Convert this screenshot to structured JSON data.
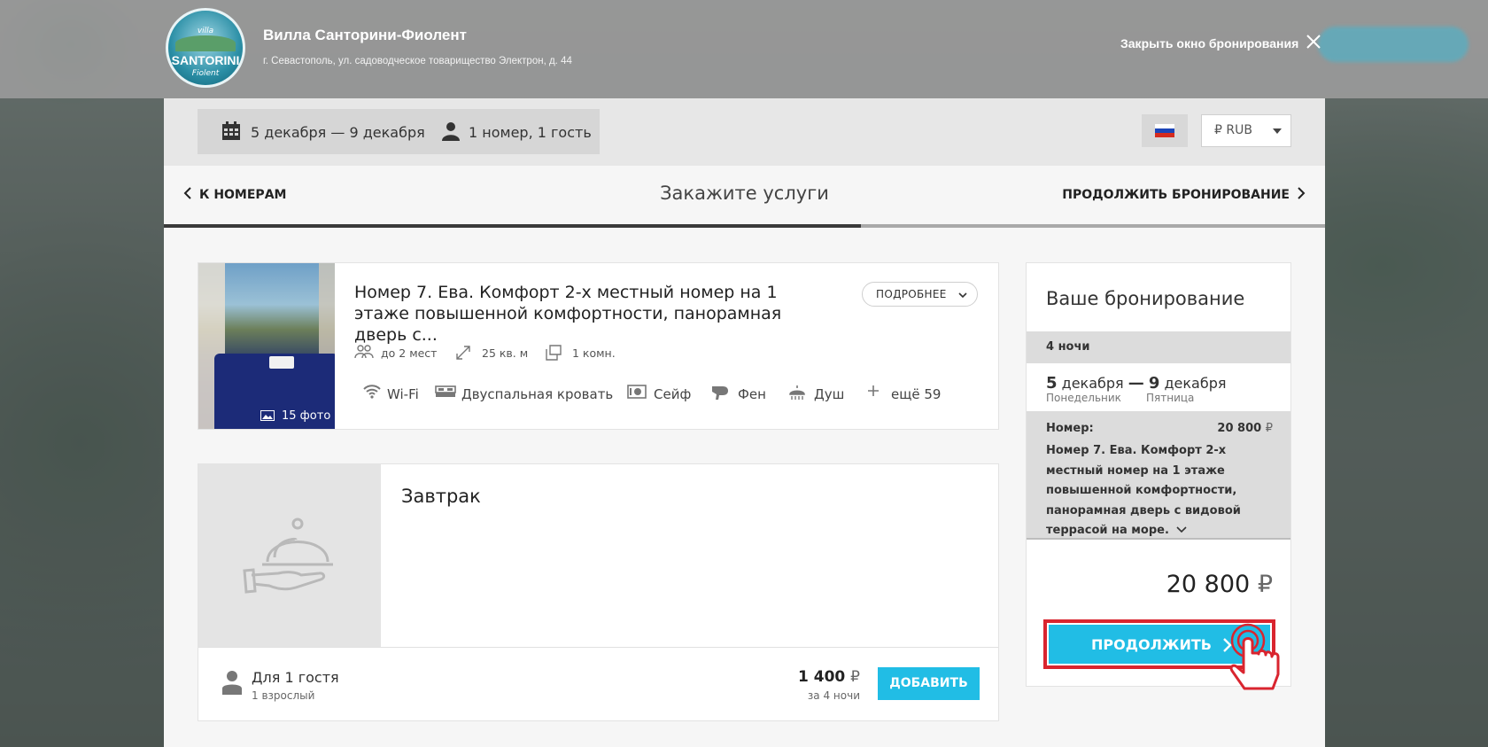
{
  "header": {
    "hotel_name": "Вилла Санторини-Фиолент",
    "address": "г. Севастополь, ул. садоводческое товарищество Электрон, д. 44",
    "close_label": "Закрыть окно бронирования",
    "logo": {
      "script": "villa",
      "main": "SANTORINI",
      "sub": "Fiolent"
    }
  },
  "search_bar": {
    "dates": "5 декабря — 9 декабря",
    "guests": "1 номер, 1 гость",
    "currency": "₽ RUB",
    "language_flag": "ru-flag-icon"
  },
  "nav": {
    "back_label": "К НОМЕРАМ",
    "title": "Закажите услуги",
    "next_label": "ПРОДОЛЖИТЬ БРОНИРОВАНИЕ",
    "progress_fraction": 0.6
  },
  "room": {
    "title": "Номер 7. Ева. Комфорт 2-х местный номер на 1 этаже повышенной комфортности, панорамная дверь с...",
    "more_label": "ПОДРОБНЕЕ",
    "photo_count": "15 фото",
    "specs": [
      "до 2 мест",
      "25 кв. м",
      "1 комн."
    ],
    "amenities": [
      "Wi-Fi",
      "Двуспальная кровать",
      "Сейф",
      "Фен",
      "Душ",
      "ещё 59"
    ]
  },
  "service": {
    "title": "Завтрак",
    "guest_label": "Для 1 гостя",
    "adults_label": "1 взрослый",
    "price": "1 400",
    "currency_symbol": "₽",
    "nights_label": "за 4 ночи",
    "add_label": "ДОБАВИТЬ"
  },
  "booking": {
    "title": "Ваше бронирование",
    "nights": "4 ночи",
    "checkin_day": "5",
    "checkin_month": "декабря",
    "checkout_day": "9",
    "checkout_month": "декабря",
    "checkin_dow": "Понедельник",
    "checkout_dow": "Пятница",
    "room_label": "Номер:",
    "room_price": "20 800",
    "room_name": "Номер 7. Ева. Комфорт 2-х местный номер на 1 этаже повышенной комфортности, панорамная дверь с видовой террасой на море.",
    "total": "20 800",
    "currency_symbol": "₽",
    "continue_label": "ПРОДОЛЖИТЬ"
  },
  "colors": {
    "accent": "#21bde5",
    "highlight": "#d9252f",
    "panel_bg": "#f6f6f6"
  }
}
